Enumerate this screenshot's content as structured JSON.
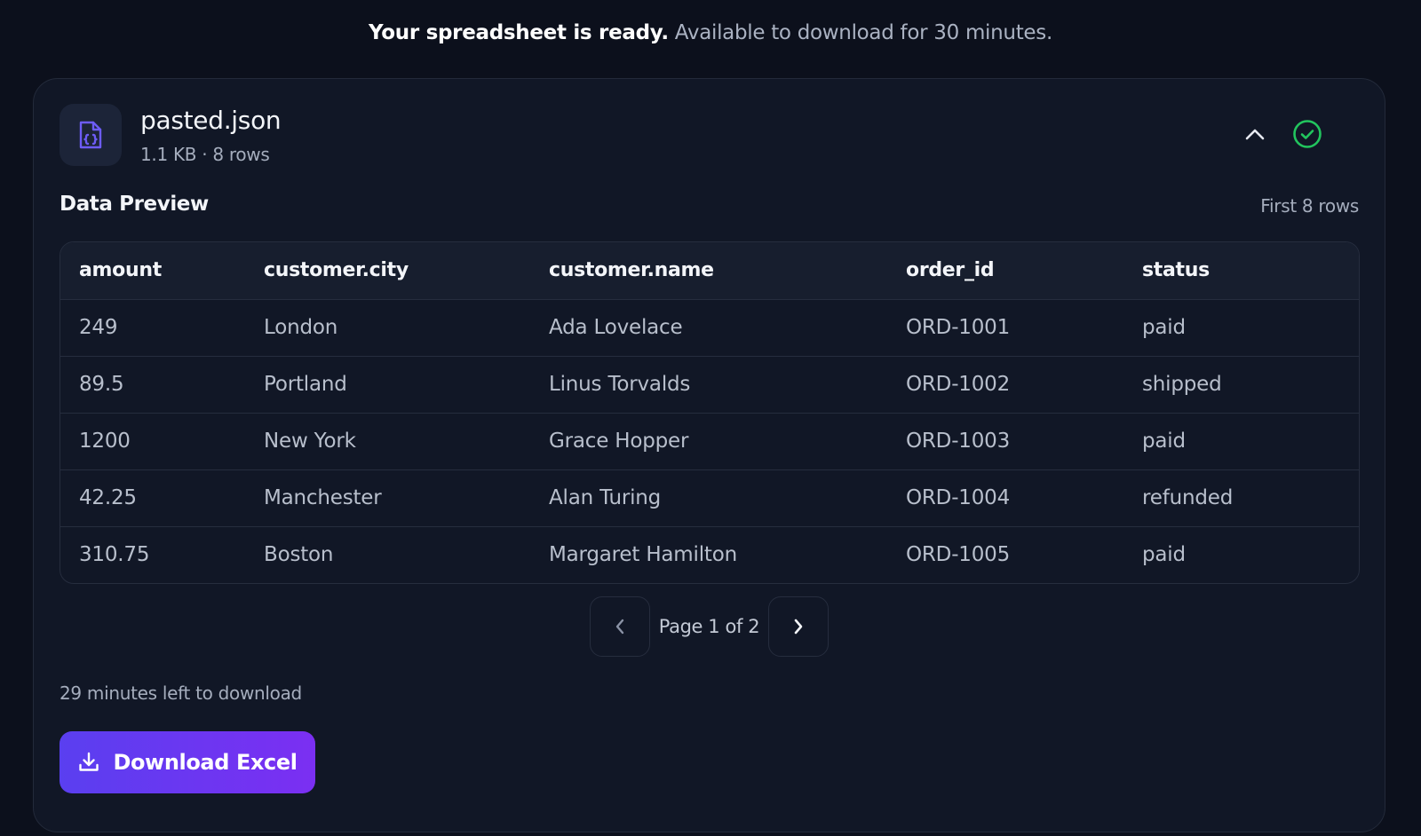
{
  "banner": {
    "strong": "Your spreadsheet is ready.",
    "rest": " Available to download for 30 minutes."
  },
  "file": {
    "name": "pasted.json",
    "meta": "1.1 KB · 8 rows",
    "icon": "json-file-icon"
  },
  "preview": {
    "title": "Data Preview",
    "note": "First 8 rows",
    "columns": [
      "amount",
      "customer.city",
      "customer.name",
      "order_id",
      "status"
    ],
    "rows": [
      [
        "249",
        "London",
        "Ada Lovelace",
        "ORD-1001",
        "paid"
      ],
      [
        "89.5",
        "Portland",
        "Linus Torvalds",
        "ORD-1002",
        "shipped"
      ],
      [
        "1200",
        "New York",
        "Grace Hopper",
        "ORD-1003",
        "paid"
      ],
      [
        "42.25",
        "Manchester",
        "Alan Turing",
        "ORD-1004",
        "refunded"
      ],
      [
        "310.75",
        "Boston",
        "Margaret Hamilton",
        "ORD-1005",
        "paid"
      ]
    ]
  },
  "pager": {
    "label": "Page 1 of 2"
  },
  "download": {
    "time_left": "29 minutes left to download",
    "button_label": "Download Excel"
  },
  "colors": {
    "accent_start": "#5a3ff0",
    "accent_end": "#7b2ff2",
    "success": "#22c55e",
    "icon_tint": "#6d5cf6"
  }
}
